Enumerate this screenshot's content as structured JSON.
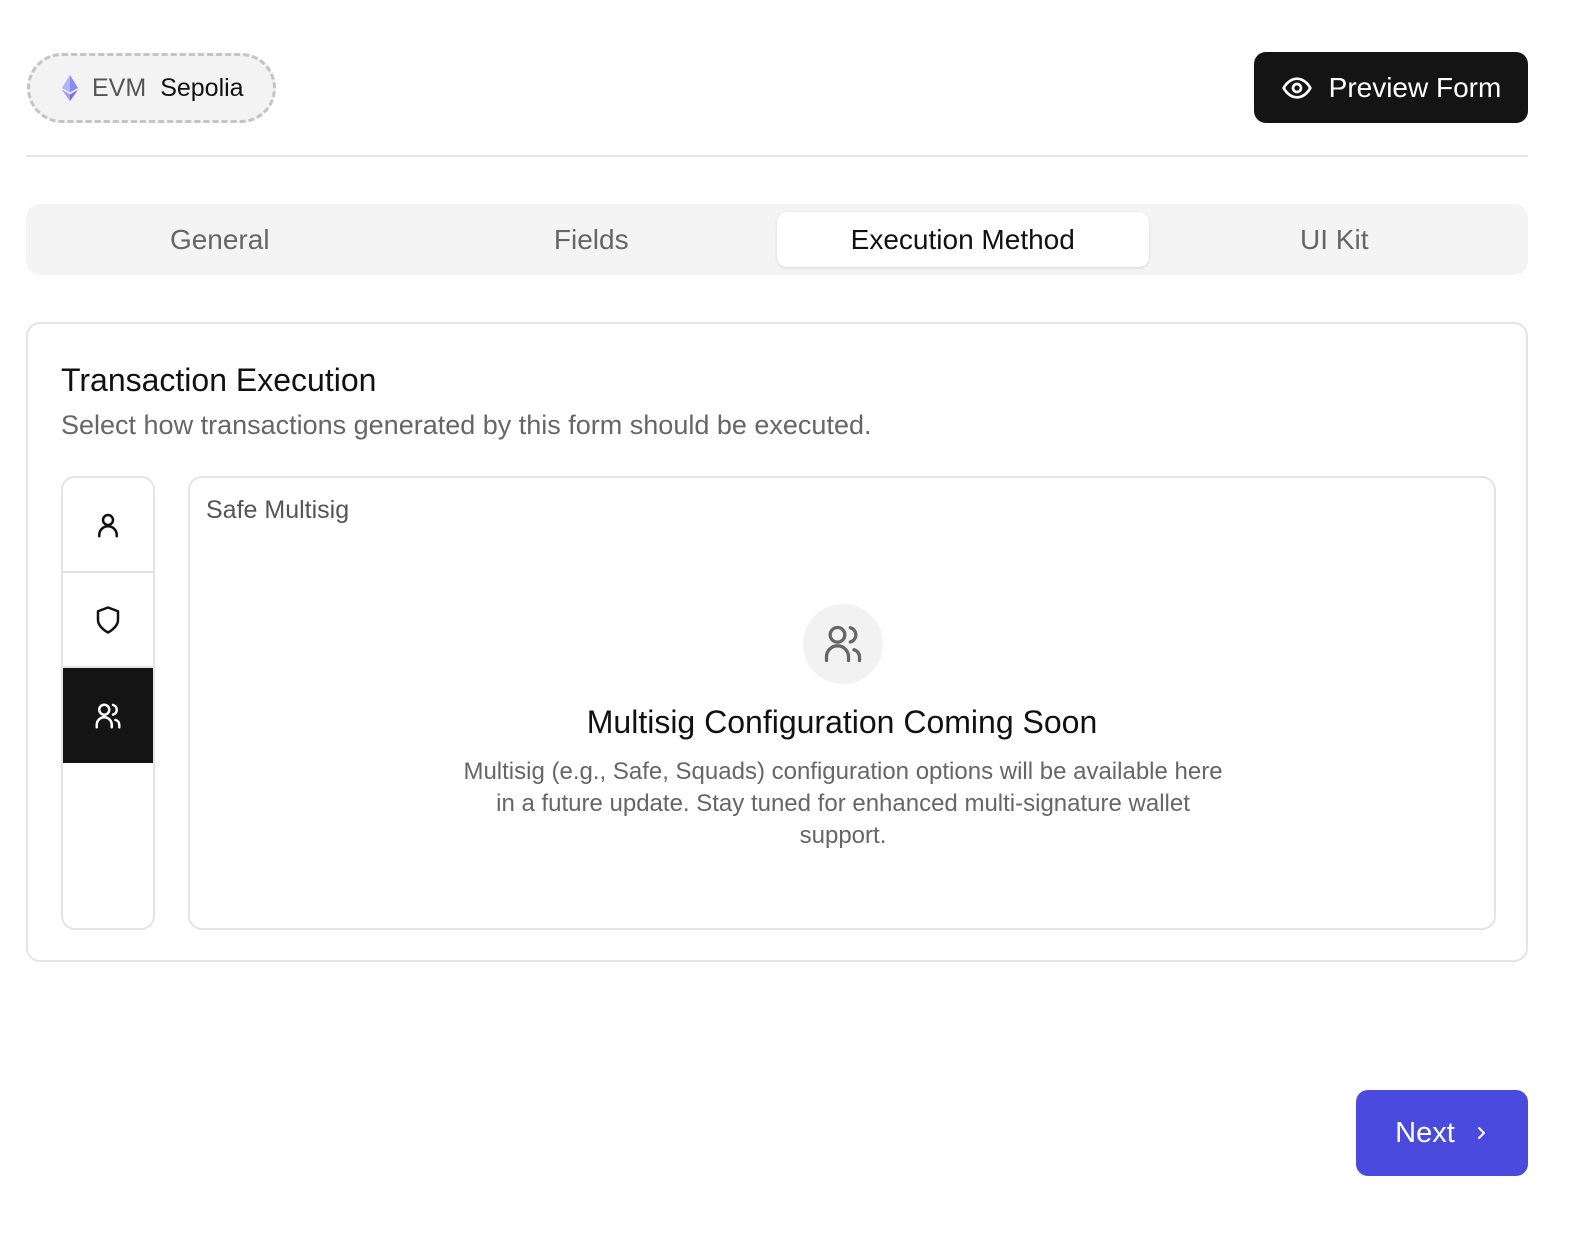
{
  "header": {
    "network": {
      "ecosystem": "EVM",
      "name": "Sepolia",
      "icon": "ethereum-icon"
    },
    "preview_button": {
      "label": "Preview Form",
      "icon": "eye-icon"
    }
  },
  "tabs": [
    {
      "label": "General",
      "active": false
    },
    {
      "label": "Fields",
      "active": false
    },
    {
      "label": "Execution Method",
      "active": true
    },
    {
      "label": "UI Kit",
      "active": false
    }
  ],
  "card": {
    "title": "Transaction Execution",
    "subtitle": "Select how transactions generated by this form should be executed.",
    "methods": [
      {
        "icon": "user-icon",
        "active": false
      },
      {
        "icon": "shield-icon",
        "active": false
      },
      {
        "icon": "users-icon",
        "active": true
      }
    ],
    "panel": {
      "label": "Safe Multisig",
      "empty_title": "Multisig Configuration Coming Soon",
      "empty_description": "Multisig (e.g., Safe, Squads) configuration options will be available here in a future update. Stay tuned for enhanced multi-signature wallet support."
    }
  },
  "footer": {
    "next_button": {
      "label": "Next",
      "icon": "chevron-right-icon"
    }
  },
  "colors": {
    "primary": "#4a4bde",
    "dark": "#141414",
    "tab_bg": "#f4f4f5",
    "border": "#e4e4e4"
  }
}
